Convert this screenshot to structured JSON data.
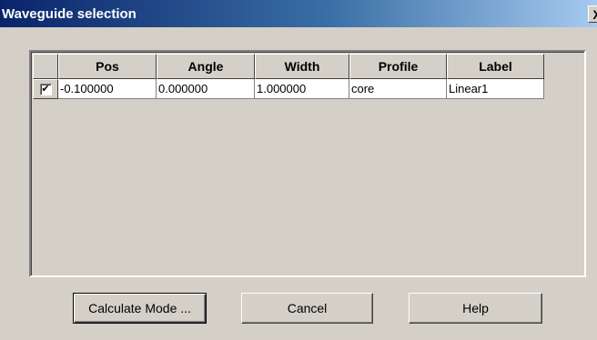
{
  "window": {
    "title": "Waveguide selection",
    "close_glyph": "X"
  },
  "grid": {
    "columns": [
      "Pos",
      "Angle",
      "Width",
      "Profile",
      "Label"
    ],
    "rows": [
      {
        "checked": true,
        "check_glyph": "✔",
        "cells": [
          "-0.100000",
          "0.000000",
          "1.000000",
          "core",
          "Linear1"
        ]
      }
    ]
  },
  "buttons": {
    "calculate": "Calculate Mode ...",
    "cancel": "Cancel",
    "help": "Help"
  }
}
